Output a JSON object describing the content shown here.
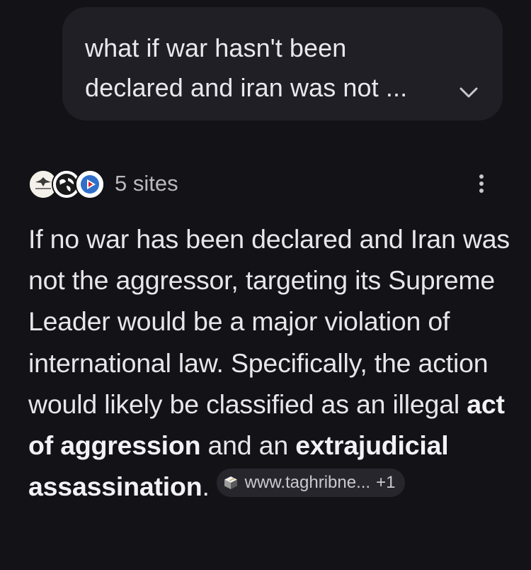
{
  "query": {
    "text": "what if war hasn't been declared and iran was not ...",
    "expand_icon": "chevron-down-icon"
  },
  "sources": {
    "favicons": [
      "eagle-emblem-icon",
      "globe-icon",
      "play-arrow-icon"
    ],
    "count_label": "5 sites",
    "menu_icon": "more-vertical-icon"
  },
  "answer": {
    "part1": "If no war has been declared and Iran was not the aggressor, targeting its Supreme Leader would be a major violation of international law. Specifically, the action would likely be classified as an illegal ",
    "bold1": "act of aggression",
    "part2": " and an ",
    "bold2": "extrajudicial assassination",
    "part3": ".",
    "citation": {
      "icon": "box-icon",
      "site": "www.taghribne...",
      "extra": "+1"
    }
  },
  "colors": {
    "background": "#131317",
    "bubble": "#1f1f25",
    "chip": "#26262c",
    "text": "#e6e6eb",
    "muted": "#b9b9c0"
  }
}
